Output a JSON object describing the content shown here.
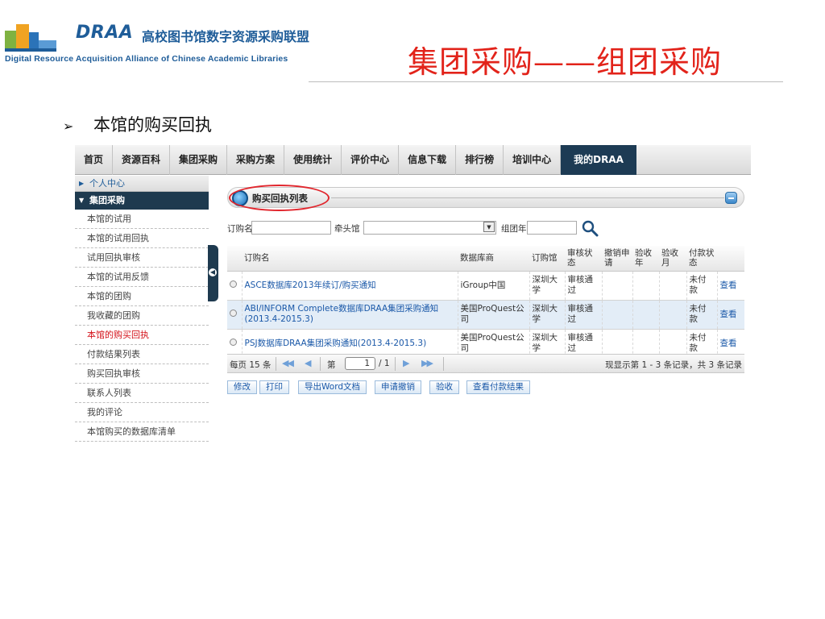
{
  "slide": {
    "logo_draa": "DRAA",
    "logo_cn": "高校图书馆数字资源采购联盟",
    "logo_en": "Digital Resource Acquisition Alliance of Chinese Academic Libraries",
    "title": "集团采购——组团采购",
    "bullet": "本馆的购买回执"
  },
  "nav": {
    "items": [
      "首页",
      "资源百科",
      "集团采购",
      "采购方案",
      "使用统计",
      "评价中心",
      "信息下载",
      "排行榜",
      "培训中心",
      "我的DRAA"
    ],
    "active": "我的DRAA"
  },
  "sidebar": {
    "personal": "个人中心",
    "group": "集团采购",
    "items": [
      "本馆的试用",
      "本馆的试用回执",
      "试用回执审核",
      "本馆的试用反馈",
      "本馆的团购",
      "我收藏的团购",
      "本馆的购买回执",
      "付款结果列表",
      "购买回执审核",
      "联系人列表",
      "我的评论",
      "本馆购买的数据库清单"
    ],
    "current": "本馆的购买回执"
  },
  "panel": {
    "title": "购买回执列表"
  },
  "filter": {
    "order_name_label": "订购名",
    "lead_lib_label": "牵头馆",
    "year_label": "组团年"
  },
  "table": {
    "headers": [
      "订购名",
      "数据库商",
      "订购馆",
      "审核状态",
      "撤销申请",
      "验收年",
      "验收月",
      "付款状态"
    ],
    "rows": [
      {
        "name": "ASCE数据库2013年续订/购买通知",
        "vendor": "iGroup中国",
        "lib": "深圳大学",
        "status": "审核通过",
        "pay": "未付款",
        "action": "查看"
      },
      {
        "name": "ABI/INFORM Complete数据库DRAA集团采购通知(2013.4-2015.3)",
        "vendor": "美国ProQuest公司",
        "lib": "深圳大学",
        "status": "审核通过",
        "pay": "未付款",
        "action": "查看"
      },
      {
        "name": "PSJ数据库DRAA集团采购通知(2013.4-2015.3)",
        "vendor": "美国ProQuest公司",
        "lib": "深圳大学",
        "status": "审核通过",
        "pay": "未付款",
        "action": "查看"
      }
    ]
  },
  "pager": {
    "per_page": "每页 15 条",
    "page_label": "第",
    "page_num": "1",
    "page_total": "/ 1",
    "summary": "现显示第 1 - 3 条记录，共 3 条记录"
  },
  "actions": [
    "修改",
    "打印",
    "导出Word文档",
    "申请撤销",
    "验收",
    "查看付款结果"
  ]
}
